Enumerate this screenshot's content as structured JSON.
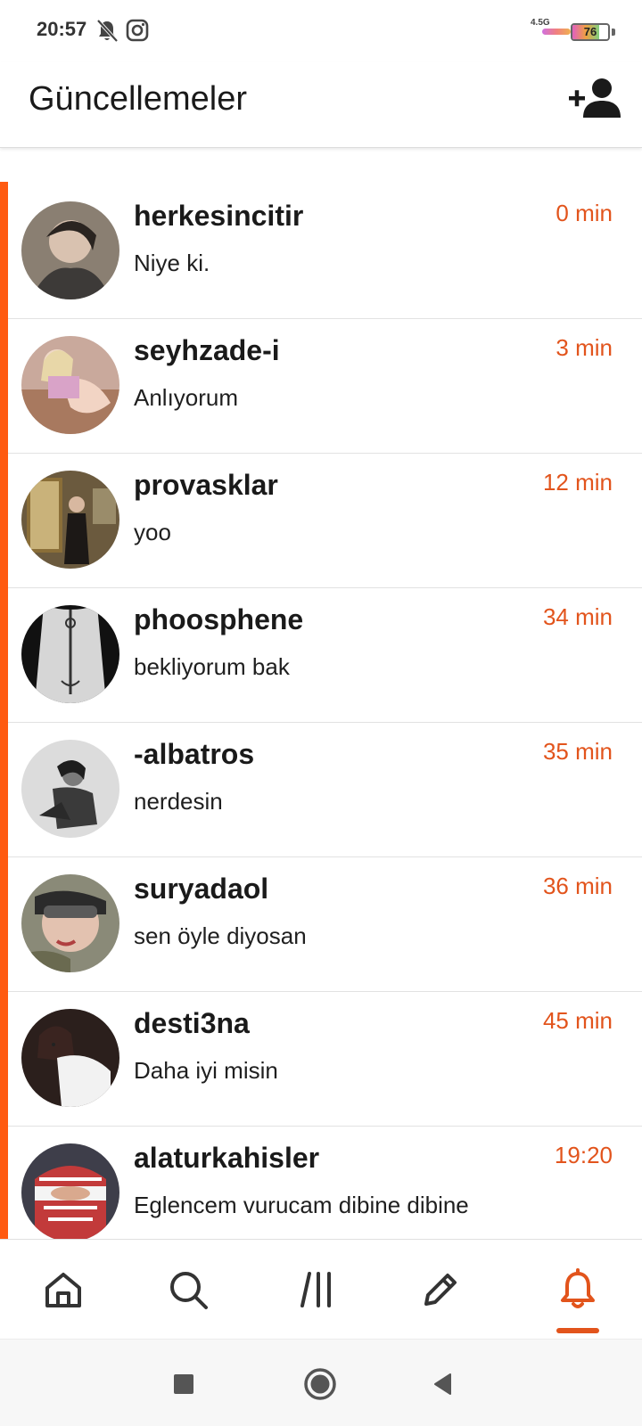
{
  "status_bar": {
    "time": "20:57",
    "network": "4.5G",
    "battery": "76",
    "battery_level": 0.76,
    "icons": [
      "bell-off-icon",
      "instagram-icon"
    ]
  },
  "header": {
    "title": "Güncellemeler",
    "add_user_icon": "add-user-icon"
  },
  "colors": {
    "accent": "#e2541c",
    "accent_bar": "#ff5a10",
    "text": "#1a1a1a",
    "divider": "#e2e2e2"
  },
  "updates": [
    {
      "username": "herkesincitir",
      "message": "Niye ki.",
      "time": "0 min"
    },
    {
      "username": "seyhzade-i",
      "message": "Anlıyorum",
      "time": "3 min"
    },
    {
      "username": "provasklar",
      "message": "yoo",
      "time": "12 min"
    },
    {
      "username": "phoosphene",
      "message": "bekliyorum bak",
      "time": "34 min"
    },
    {
      "username": "-albatros",
      "message": "nerdesin",
      "time": "35 min"
    },
    {
      "username": "suryadaol",
      "message": "sen öyle diyosan",
      "time": "36 min"
    },
    {
      "username": "desti3na",
      "message": "Daha iyi misin",
      "time": "45 min"
    },
    {
      "username": "alaturkahisler",
      "message": "Eglencem vurucam dibine dibine",
      "time": "19:20"
    }
  ],
  "bottom_nav": {
    "items": [
      "home-icon",
      "search-icon",
      "feed-icon",
      "edit-icon",
      "bell-icon"
    ],
    "active": "bell-icon"
  },
  "system_nav": {
    "items": [
      "recents-square-icon",
      "home-circle-icon",
      "back-triangle-icon"
    ]
  }
}
